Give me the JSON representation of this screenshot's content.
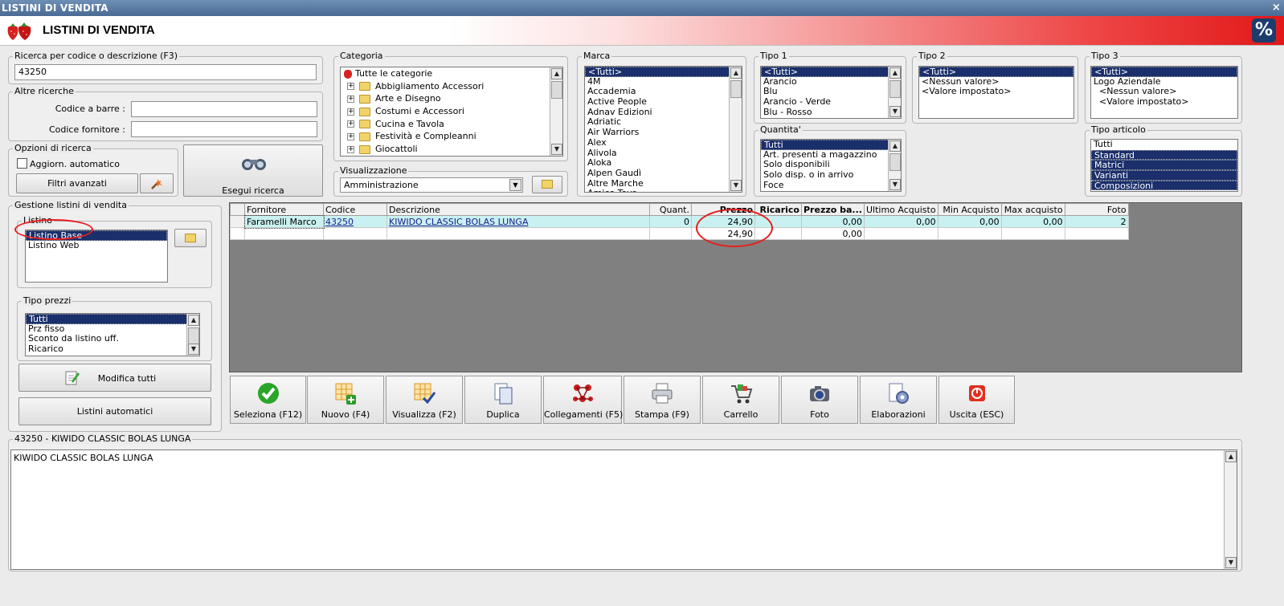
{
  "window": {
    "title": "LISTINI DI VENDITA",
    "close_glyph": "×"
  },
  "banner": {
    "title": "LISTINI DI VENDITA",
    "percent_glyph": "%"
  },
  "search": {
    "legend": "Ricerca per codice o descrizione (F3)",
    "value": "43250"
  },
  "other_search": {
    "legend": "Altre ricerche",
    "barcode_label": "Codice a barre :",
    "barcode_value": "",
    "supplier_code_label": "Codice fornitore :",
    "supplier_code_value": ""
  },
  "search_options": {
    "legend": "Opzioni di ricerca",
    "auto_update_label": "Aggiorn. automatico",
    "auto_update_checked": false,
    "advanced_filters_label": "Filtri avanzati"
  },
  "run_search": {
    "label": "Esegui ricerca"
  },
  "category": {
    "legend": "Categoria",
    "items": [
      "Tutte le categorie",
      "Abbigliamento Accessori",
      "Arte e Disegno",
      "Costumi e Accessori",
      "Cucina e Tavola",
      "Festività e Compleanni",
      "Giocattoli"
    ]
  },
  "view": {
    "legend": "Visualizzazione",
    "value": "Amministrazione"
  },
  "brand": {
    "legend": "Marca",
    "items": [
      "<Tutti>",
      "4M",
      "Accademia",
      "Active People",
      "Adnav Edizioni",
      "Adriatic",
      "Air Warriors",
      "Alex",
      "Alivola",
      "Aloka",
      "Alpen Gaudì",
      "Altre Marche",
      "Amico Toys"
    ],
    "selected": 0
  },
  "type1": {
    "legend": "Tipo 1",
    "items": [
      "<Tutti>",
      "Arancio",
      "Blu",
      "Arancio - Verde",
      "Blu - Rosso"
    ],
    "selected": 0
  },
  "type2": {
    "legend": "Tipo 2",
    "items": [
      "<Tutti>",
      "<Nessun valore>",
      "<Valore impostato>"
    ],
    "selected": 0
  },
  "type3": {
    "legend": "Tipo 3",
    "items": [
      "<Tutti>",
      "Logo Aziendale",
      "<Nessun valore>",
      "<Valore impostato>"
    ],
    "selected": 0
  },
  "quantity": {
    "legend": "Quantita'",
    "items": [
      "Tutti",
      "Art. presenti a magazzino",
      "Solo disponibili",
      "Solo disp. o in arrivo",
      "Foce"
    ],
    "selected": 0
  },
  "article_type": {
    "legend": "Tipo articolo",
    "items": [
      "Tutti",
      "Standard",
      "Matrici",
      "Varianti",
      "Composizioni"
    ],
    "selected": [
      1,
      2,
      3,
      4
    ]
  },
  "price_lists": {
    "legend": "Gestione listini di vendita",
    "list_legend": "Listino",
    "items": [
      "Listino Base",
      "Listino Web"
    ],
    "selected": 0
  },
  "price_types": {
    "legend": "Tipo prezzi",
    "items": [
      "Tutti",
      "Prz fisso",
      "Sconto da listino uff.",
      "Ricarico"
    ],
    "selected": 0
  },
  "buttons": {
    "edit_all": "Modifica tutti",
    "auto_lists": "Listini automatici"
  },
  "grid": {
    "columns": [
      "",
      "Fornitore",
      "Codice",
      "Descrizione",
      "Quant.",
      "Prezzo",
      "Ricarico",
      "Prezzo ba...",
      "Ultimo Acquisto",
      "Min Acquisto",
      "Max acquisto",
      "Foto"
    ],
    "rows": [
      [
        "",
        "Faramelli Marco",
        "43250",
        "KIWIDO CLASSIC BOLAS LUNGA",
        "0",
        "24,90",
        "",
        "0,00",
        "0,00",
        "0,00",
        "0,00",
        "2"
      ],
      [
        "",
        "",
        "",
        "",
        "",
        "24,90",
        "",
        "0,00",
        "",
        "",
        "",
        ""
      ]
    ]
  },
  "toolbar": [
    {
      "label": "Seleziona (F12)",
      "icon": "check-icon"
    },
    {
      "label": "Nuovo (F4)",
      "icon": "grid-add-icon"
    },
    {
      "label": "Visualizza (F2)",
      "icon": "grid-check-icon"
    },
    {
      "label": "Duplica",
      "icon": "duplicate-icon"
    },
    {
      "label": "Collegamenti (F5)",
      "icon": "links-icon"
    },
    {
      "label": "Stampa (F9)",
      "icon": "printer-icon"
    },
    {
      "label": "Carrello",
      "icon": "cart-icon"
    },
    {
      "label": "Foto",
      "icon": "camera-icon"
    },
    {
      "label": "Elaborazioni",
      "icon": "processing-icon"
    },
    {
      "label": "Uscita (ESC)",
      "icon": "exit-icon"
    }
  ],
  "detail": {
    "legend": "43250 - KIWIDO CLASSIC BOLAS LUNGA",
    "text": "KIWIDO CLASSIC BOLAS LUNGA"
  },
  "colors": {
    "selection": "#1a2f6b",
    "row_highlight": "#c9f1f1",
    "annotation": "#e61e1e",
    "grid_bg": "#808080"
  }
}
